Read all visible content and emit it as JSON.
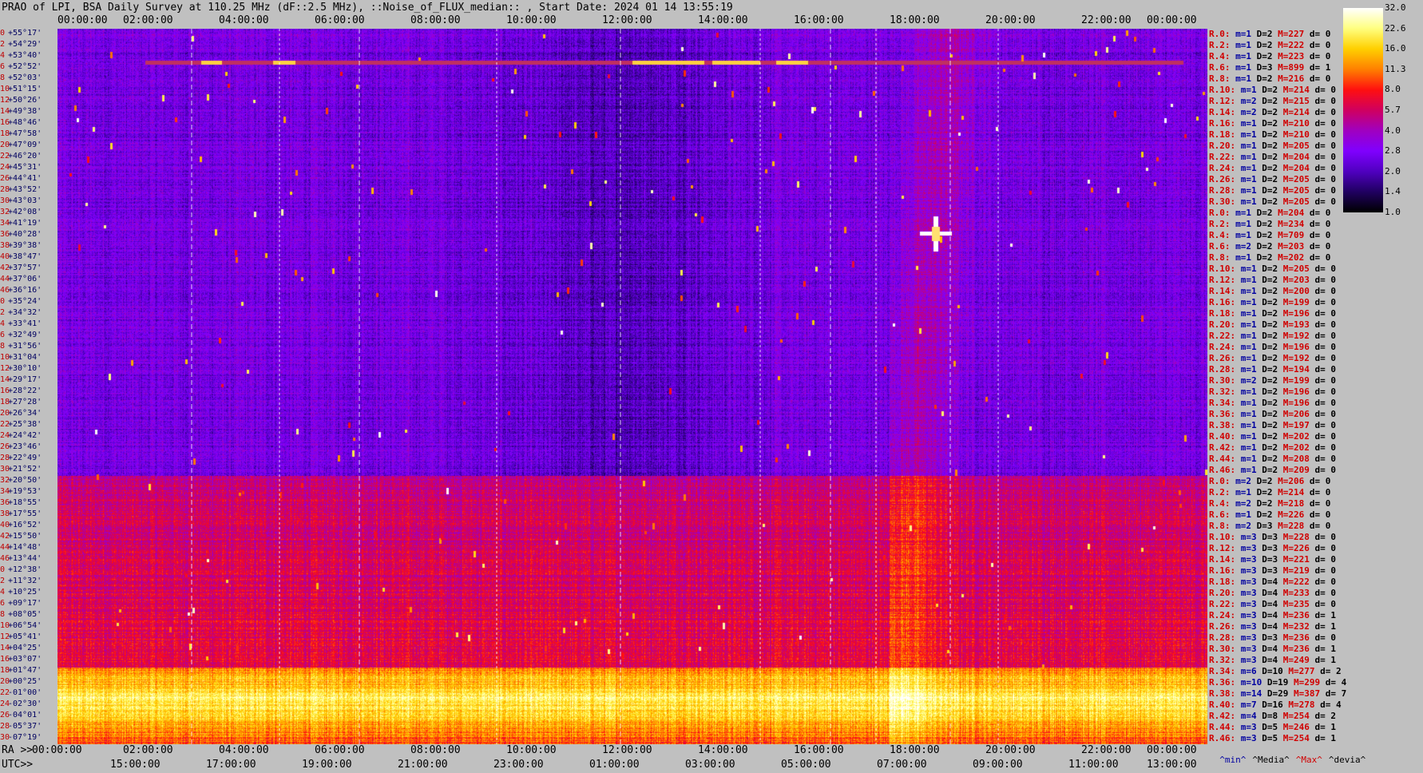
{
  "header": {
    "title": "PRAO of LPI, BSA Daily Survey at 110.25 MHz (dF::2.5 MHz), ::Noise_of_FLUX_median:: , Start Date: 2024 01 14 13:55:19"
  },
  "axes": {
    "top_ticks": [
      "00:00:00",
      "02:00:00",
      "04:00:00",
      "06:00:00",
      "08:00:00",
      "10:00:00",
      "12:00:00",
      "14:00:00",
      "16:00:00",
      "18:00:00",
      "20:00:00",
      "22:00:00",
      "00:00:00"
    ],
    "ra_prefix": "RA >>",
    "ra_ticks": [
      "00:00:00",
      "02:00:00",
      "04:00:00",
      "06:00:00",
      "08:00:00",
      "10:00:00",
      "12:00:00",
      "14:00:00",
      "16:00:00",
      "18:00:00",
      "20:00:00",
      "22:00:00",
      "00:00:00"
    ],
    "utc_prefix": "UTC>>",
    "utc_ticks": [
      "15:00:00",
      "17:00:00",
      "19:00:00",
      "21:00:00",
      "23:00:00",
      "01:00:00",
      "03:00:00",
      "05:00:00",
      "07:00:00",
      "09:00:00",
      "11:00:00",
      "13:00:00"
    ]
  },
  "row_labels": [
    {
      "n": "0",
      "dec": "+55°17'"
    },
    {
      "n": "2",
      "dec": "+54°29'"
    },
    {
      "n": "4",
      "dec": "+53°40'"
    },
    {
      "n": "6",
      "dec": "+52°52'"
    },
    {
      "n": "8",
      "dec": "+52°03'"
    },
    {
      "n": "10",
      "dec": "+51°15'"
    },
    {
      "n": "12",
      "dec": "+50°26'"
    },
    {
      "n": "14",
      "dec": "+49°38'"
    },
    {
      "n": "16",
      "dec": "+48°46'"
    },
    {
      "n": "18",
      "dec": "+47°58'"
    },
    {
      "n": "20",
      "dec": "+47°09'"
    },
    {
      "n": "22",
      "dec": "+46°20'"
    },
    {
      "n": "24",
      "dec": "+45°31'"
    },
    {
      "n": "26",
      "dec": "+44°41'"
    },
    {
      "n": "28",
      "dec": "+43°52'"
    },
    {
      "n": "30",
      "dec": "+43°03'"
    },
    {
      "n": "32",
      "dec": "+42°08'"
    },
    {
      "n": "34",
      "dec": "+41°19'"
    },
    {
      "n": "36",
      "dec": "+40°28'"
    },
    {
      "n": "38",
      "dec": "+39°38'"
    },
    {
      "n": "40",
      "dec": "+38°47'"
    },
    {
      "n": "42",
      "dec": "+37°57'"
    },
    {
      "n": "44",
      "dec": "+37°06'"
    },
    {
      "n": "46",
      "dec": "+36°16'"
    },
    {
      "n": "0",
      "dec": "+35°24'"
    },
    {
      "n": "2",
      "dec": "+34°32'"
    },
    {
      "n": "4",
      "dec": "+33°41'"
    },
    {
      "n": "6",
      "dec": "+32°49'"
    },
    {
      "n": "8",
      "dec": "+31°56'"
    },
    {
      "n": "10",
      "dec": "+31°04'"
    },
    {
      "n": "12",
      "dec": "+30°10'"
    },
    {
      "n": "14",
      "dec": "+29°17'"
    },
    {
      "n": "16",
      "dec": "+28°22'"
    },
    {
      "n": "18",
      "dec": "+27°28'"
    },
    {
      "n": "20",
      "dec": "+26°34'"
    },
    {
      "n": "22",
      "dec": "+25°38'"
    },
    {
      "n": "24",
      "dec": "+24°42'"
    },
    {
      "n": "26",
      "dec": "+23°46'"
    },
    {
      "n": "28",
      "dec": "+22°49'"
    },
    {
      "n": "30",
      "dec": "+21°52'"
    },
    {
      "n": "32",
      "dec": "+20°50'"
    },
    {
      "n": "34",
      "dec": "+19°53'"
    },
    {
      "n": "36",
      "dec": "+18°55'"
    },
    {
      "n": "38",
      "dec": "+17°55'"
    },
    {
      "n": "40",
      "dec": "+16°52'"
    },
    {
      "n": "42",
      "dec": "+15°50'"
    },
    {
      "n": "44",
      "dec": "+14°48'"
    },
    {
      "n": "46",
      "dec": "+13°44'"
    },
    {
      "n": "0",
      "dec": "+12°38'"
    },
    {
      "n": "2",
      "dec": "+11°32'"
    },
    {
      "n": "4",
      "dec": "+10°25'"
    },
    {
      "n": "6",
      "dec": "+09°17'"
    },
    {
      "n": "8",
      "dec": "+08°05'"
    },
    {
      "n": "10",
      "dec": "+06°54'"
    },
    {
      "n": "12",
      "dec": "+05°41'"
    },
    {
      "n": "14",
      "dec": "+04°25'"
    },
    {
      "n": "16",
      "dec": "+03°07'"
    },
    {
      "n": "18",
      "dec": "+01°47'"
    },
    {
      "n": "20",
      "dec": "+00°25'"
    },
    {
      "n": "22",
      "dec": "-01°00'"
    },
    {
      "n": "24",
      "dec": "-02°30'"
    },
    {
      "n": "26",
      "dec": "-04°01'"
    },
    {
      "n": "28",
      "dec": "-05°37'"
    },
    {
      "n": "30",
      "dec": "-07°19'"
    }
  ],
  "stats": [
    {
      "r": "R.0:",
      "m": "1",
      "D": "2",
      "M": "227",
      "d": "0"
    },
    {
      "r": "R.2:",
      "m": "1",
      "D": "2",
      "M": "222",
      "d": "0"
    },
    {
      "r": "R.4:",
      "m": "1",
      "D": "2",
      "M": "223",
      "d": "0"
    },
    {
      "r": "R.6:",
      "m": "1",
      "D": "3",
      "M": "899",
      "d": "1"
    },
    {
      "r": "R.8:",
      "m": "1",
      "D": "2",
      "M": "216",
      "d": "0"
    },
    {
      "r": "R.10:",
      "m": "1",
      "D": "2",
      "M": "214",
      "d": "0"
    },
    {
      "r": "R.12:",
      "m": "2",
      "D": "2",
      "M": "215",
      "d": "0"
    },
    {
      "r": "R.14:",
      "m": "2",
      "D": "2",
      "M": "214",
      "d": "0"
    },
    {
      "r": "R.16:",
      "m": "1",
      "D": "2",
      "M": "210",
      "d": "0"
    },
    {
      "r": "R.18:",
      "m": "1",
      "D": "2",
      "M": "210",
      "d": "0"
    },
    {
      "r": "R.20:",
      "m": "1",
      "D": "2",
      "M": "205",
      "d": "0"
    },
    {
      "r": "R.22:",
      "m": "1",
      "D": "2",
      "M": "204",
      "d": "0"
    },
    {
      "r": "R.24:",
      "m": "1",
      "D": "2",
      "M": "204",
      "d": "0"
    },
    {
      "r": "R.26:",
      "m": "1",
      "D": "2",
      "M": "205",
      "d": "0"
    },
    {
      "r": "R.28:",
      "m": "1",
      "D": "2",
      "M": "205",
      "d": "0"
    },
    {
      "r": "R.30:",
      "m": "1",
      "D": "2",
      "M": "205",
      "d": "0"
    },
    {
      "r": "R.0:",
      "m": "1",
      "D": "2",
      "M": "204",
      "d": "0"
    },
    {
      "r": "R.2:",
      "m": "1",
      "D": "2",
      "M": "234",
      "d": "0"
    },
    {
      "r": "R.4:",
      "m": "1",
      "D": "2",
      "M": "709",
      "d": "0"
    },
    {
      "r": "R.6:",
      "m": "2",
      "D": "2",
      "M": "203",
      "d": "0"
    },
    {
      "r": "R.8:",
      "m": "1",
      "D": "2",
      "M": "202",
      "d": "0"
    },
    {
      "r": "R.10:",
      "m": "1",
      "D": "2",
      "M": "205",
      "d": "0"
    },
    {
      "r": "R.12:",
      "m": "1",
      "D": "2",
      "M": "203",
      "d": "0"
    },
    {
      "r": "R.14:",
      "m": "1",
      "D": "2",
      "M": "200",
      "d": "0"
    },
    {
      "r": "R.16:",
      "m": "1",
      "D": "2",
      "M": "199",
      "d": "0"
    },
    {
      "r": "R.18:",
      "m": "1",
      "D": "2",
      "M": "196",
      "d": "0"
    },
    {
      "r": "R.20:",
      "m": "1",
      "D": "2",
      "M": "193",
      "d": "0"
    },
    {
      "r": "R.22:",
      "m": "1",
      "D": "2",
      "M": "192",
      "d": "0"
    },
    {
      "r": "R.24:",
      "m": "1",
      "D": "2",
      "M": "196",
      "d": "0"
    },
    {
      "r": "R.26:",
      "m": "1",
      "D": "2",
      "M": "192",
      "d": "0"
    },
    {
      "r": "R.28:",
      "m": "1",
      "D": "2",
      "M": "194",
      "d": "0"
    },
    {
      "r": "R.30:",
      "m": "2",
      "D": "2",
      "M": "199",
      "d": "0"
    },
    {
      "r": "R.32:",
      "m": "1",
      "D": "2",
      "M": "196",
      "d": "0"
    },
    {
      "r": "R.34:",
      "m": "1",
      "D": "2",
      "M": "196",
      "d": "0"
    },
    {
      "r": "R.36:",
      "m": "1",
      "D": "2",
      "M": "206",
      "d": "0"
    },
    {
      "r": "R.38:",
      "m": "1",
      "D": "2",
      "M": "197",
      "d": "0"
    },
    {
      "r": "R.40:",
      "m": "1",
      "D": "2",
      "M": "202",
      "d": "0"
    },
    {
      "r": "R.42:",
      "m": "1",
      "D": "2",
      "M": "202",
      "d": "0"
    },
    {
      "r": "R.44:",
      "m": "1",
      "D": "2",
      "M": "208",
      "d": "0"
    },
    {
      "r": "R.46:",
      "m": "1",
      "D": "2",
      "M": "209",
      "d": "0"
    },
    {
      "r": "R.0:",
      "m": "2",
      "D": "2",
      "M": "206",
      "d": "0"
    },
    {
      "r": "R.2:",
      "m": "1",
      "D": "2",
      "M": "214",
      "d": "0"
    },
    {
      "r": "R.4:",
      "m": "2",
      "D": "2",
      "M": "218",
      "d": "0"
    },
    {
      "r": "R.6:",
      "m": "1",
      "D": "2",
      "M": "226",
      "d": "0"
    },
    {
      "r": "R.8:",
      "m": "2",
      "D": "3",
      "M": "228",
      "d": "0"
    },
    {
      "r": "R.10:",
      "m": "3",
      "D": "3",
      "M": "228",
      "d": "0"
    },
    {
      "r": "R.12:",
      "m": "3",
      "D": "3",
      "M": "226",
      "d": "0"
    },
    {
      "r": "R.14:",
      "m": "3",
      "D": "3",
      "M": "221",
      "d": "0"
    },
    {
      "r": "R.16:",
      "m": "3",
      "D": "3",
      "M": "219",
      "d": "0"
    },
    {
      "r": "R.18:",
      "m": "3",
      "D": "4",
      "M": "222",
      "d": "0"
    },
    {
      "r": "R.20:",
      "m": "3",
      "D": "4",
      "M": "233",
      "d": "0"
    },
    {
      "r": "R.22:",
      "m": "3",
      "D": "4",
      "M": "235",
      "d": "0"
    },
    {
      "r": "R.24:",
      "m": "3",
      "D": "4",
      "M": "236",
      "d": "1"
    },
    {
      "r": "R.26:",
      "m": "3",
      "D": "4",
      "M": "232",
      "d": "1"
    },
    {
      "r": "R.28:",
      "m": "3",
      "D": "3",
      "M": "236",
      "d": "0"
    },
    {
      "r": "R.30:",
      "m": "3",
      "D": "4",
      "M": "236",
      "d": "1"
    },
    {
      "r": "R.32:",
      "m": "3",
      "D": "4",
      "M": "249",
      "d": "1"
    },
    {
      "r": "R.34:",
      "m": "6",
      "D": "10",
      "M": "277",
      "d": "2"
    },
    {
      "r": "R.36:",
      "m": "10",
      "D": "19",
      "M": "299",
      "d": "4"
    },
    {
      "r": "R.38:",
      "m": "14",
      "D": "29",
      "M": "387",
      "d": "7"
    },
    {
      "r": "R.40:",
      "m": "7",
      "D": "16",
      "M": "278",
      "d": "4"
    },
    {
      "r": "R.42:",
      "m": "4",
      "D": "8",
      "M": "254",
      "d": "2"
    },
    {
      "r": "R.44:",
      "m": "3",
      "D": "5",
      "M": "246",
      "d": "1"
    },
    {
      "r": "R.46:",
      "m": "3",
      "D": "5",
      "M": "254",
      "d": "1"
    }
  ],
  "legend": {
    "min": "^min^",
    "media": "^Media^",
    "max": "^Max^",
    "devia": "^devia^"
  },
  "colorbar": {
    "ticks": [
      "32.0",
      "22.6",
      "16.0",
      "11.3",
      "8.0",
      "5.7",
      "4.0",
      "2.8",
      "2.0",
      "1.4",
      "1.0"
    ],
    "stops": [
      "#ffffff",
      "#ffff80",
      "#ffd000",
      "#ff8000",
      "#ff1010",
      "#d00060",
      "#a000c0",
      "#8000ff",
      "#5000c0",
      "#200060",
      "#000000"
    ]
  },
  "chart_data": {
    "type": "heatmap",
    "x_axis": "RA 00:00:00 - 00:00:00 (24h)",
    "y_axis": "Declination +55°17' to -07°19'",
    "scale": "log",
    "vmin": 1.0,
    "vmax": 32.0,
    "features": [
      {
        "desc": "bright horizontal band",
        "dec_range": [
          "+01°47'",
          "-02°30'"
        ],
        "level": "max ~32"
      },
      {
        "desc": "elevated band",
        "dec_range": [
          "+16°52'",
          "+03°07'"
        ],
        "level": "~5-8"
      },
      {
        "desc": "bright source",
        "ra": "19:55",
        "dec": "+41°19'"
      },
      {
        "desc": "interference line",
        "dec": "+52°52'"
      }
    ]
  }
}
